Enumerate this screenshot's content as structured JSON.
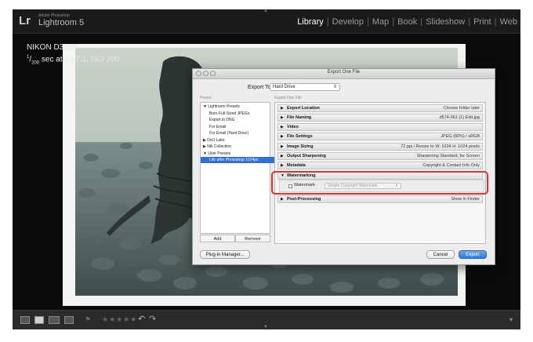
{
  "app": {
    "logo": "Lr",
    "vendor": "Adobe Photoshop",
    "name": "Lightroom 5"
  },
  "modules": [
    "Library",
    "Develop",
    "Map",
    "Book",
    "Slideshow",
    "Print",
    "Web"
  ],
  "active_module": "Library",
  "camera_info": {
    "model": "NIKON D3005",
    "exposure_num": "1",
    "exposure_den": "200",
    "exposure_rest": "sec at ƒ / 7.1, ISO 200"
  },
  "toolbar": {
    "stars": "★★★★★",
    "flag": "⚑",
    "rotate_left": "↶",
    "rotate_right": "↷",
    "expand": "▾"
  },
  "dialog": {
    "title": "Export One File",
    "export_to_label": "Export To:",
    "export_to_value": "Hard Drive",
    "preset_label": "Preset:",
    "section_label": "Export One File",
    "presets": [
      {
        "label": "▼ Lightroom Presets",
        "indent": 0
      },
      {
        "label": "Burn Full-Sized JPEGs",
        "indent": 2
      },
      {
        "label": "Export to DNG",
        "indent": 2
      },
      {
        "label": "For Email",
        "indent": 2
      },
      {
        "label": "For Email (Hard Drive)",
        "indent": 2
      },
      {
        "label": "▶ DxO Labs",
        "indent": 0
      },
      {
        "label": "▶ Nik Collection",
        "indent": 0
      },
      {
        "label": "▼ User Presets",
        "indent": 0
      },
      {
        "label": "Life after Photoshop 1024px",
        "indent": 2,
        "selected": true
      }
    ],
    "add_label": "Add",
    "remove_label": "Remove",
    "sections": [
      {
        "name": "Export Location",
        "summary": "Choose folder later"
      },
      {
        "name": "File Naming",
        "summary": "d574-061 (1) Edit.jpg"
      },
      {
        "name": "Video",
        "summary": ""
      },
      {
        "name": "File Settings",
        "summary": "JPEG (80%) / sRGB"
      },
      {
        "name": "Image Sizing",
        "summary": "72 ppi / Resize to W: 1024 H: 1024 pixels"
      },
      {
        "name": "Output Sharpening",
        "summary": "Sharpening Standard, for Screen"
      },
      {
        "name": "Metadata",
        "summary": "Copyright & Contact Info Only"
      }
    ],
    "watermarking": {
      "name": "Watermarking",
      "checkbox_label": "Watermark:",
      "select_value": "Simple Copyright Watermark"
    },
    "post_processing": {
      "name": "Post-Processing",
      "summary": "Show in Finder"
    },
    "plugin_manager_label": "Plug-in Manager...",
    "cancel_label": "Cancel",
    "export_label": "Export"
  },
  "colors": {
    "highlight": "#e03131",
    "selection": "#2f6fd6",
    "primary_button": "#2f79d9"
  }
}
